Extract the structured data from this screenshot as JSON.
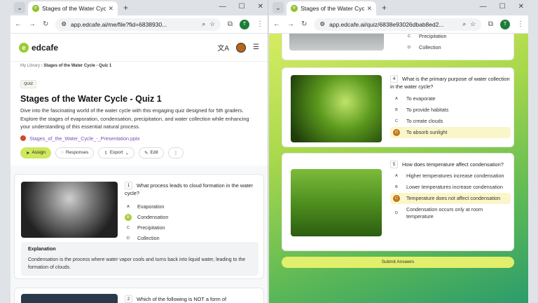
{
  "left_window": {
    "tab_title": "Stages of the Water Cycle - Quiz",
    "url": "app.edcafe.ai/me/file?fid=6838930...",
    "profile_initial": "T",
    "app": {
      "logo": "edcafe"
    },
    "breadcrumb": {
      "root": "My Library",
      "current": "Stages of the Water Cycle - Quiz 1"
    },
    "quiz": {
      "badge": "QUIZ",
      "title": "Stages of the Water Cycle - Quiz 1",
      "description": "Dive into the fascinating world of the water cycle with this engaging quiz designed for 5th graders. Explore the stages of evaporation, condensation, precipitation, and water collection while enhancing your understanding of this essential natural process.",
      "file": "Stages_of_the_Water_Cycle_-_Presentation.pptx",
      "actions": {
        "assign": "Assign",
        "responses": "Responses",
        "export": "Export",
        "edit": "Edit"
      }
    },
    "questions": [
      {
        "num": "1",
        "text": "What process leads to cloud formation in the water cycle?",
        "options": [
          {
            "letter": "A",
            "text": "Evaporation"
          },
          {
            "letter": "B",
            "text": "Condensation",
            "selected": true
          },
          {
            "letter": "C",
            "text": "Precipitation"
          },
          {
            "letter": "D",
            "text": "Collection"
          }
        ],
        "explanation_title": "Explanation",
        "explanation": "Condensation is the process where water vapor cools and turns back into liquid water, leading to the formation of clouds."
      },
      {
        "num": "2",
        "text": "Which of the following is NOT a form of"
      }
    ]
  },
  "right_window": {
    "tab_title": "Stages of the Water Cycle - Quiz",
    "url": "app.edcafe.ai/quiz/6838e93026dbab8ed2...",
    "profile_initial": "T",
    "prev_options": [
      {
        "letter": "C",
        "text": "Precipitation"
      },
      {
        "letter": "D",
        "text": "Collection"
      }
    ],
    "questions": [
      {
        "num": "4",
        "text": "What is the primary purpose of water collection in the water cycle?",
        "options": [
          {
            "letter": "A",
            "text": "To evaporate"
          },
          {
            "letter": "B",
            "text": "To provide habitats"
          },
          {
            "letter": "C",
            "text": "To create clouds"
          },
          {
            "letter": "D",
            "text": "To absorb sunlight",
            "selected": true
          }
        ]
      },
      {
        "num": "5",
        "text": "How does temperature affect condensation?",
        "options": [
          {
            "letter": "A",
            "text": "Higher temperatures increase condensation"
          },
          {
            "letter": "B",
            "text": "Lower temperatures increase condensation"
          },
          {
            "letter": "C",
            "text": "Temperature does not affect condensation",
            "selected": true
          },
          {
            "letter": "D",
            "text": "Condensation occurs only at room temperature"
          }
        ]
      }
    ],
    "submit": "Submit Answers"
  }
}
